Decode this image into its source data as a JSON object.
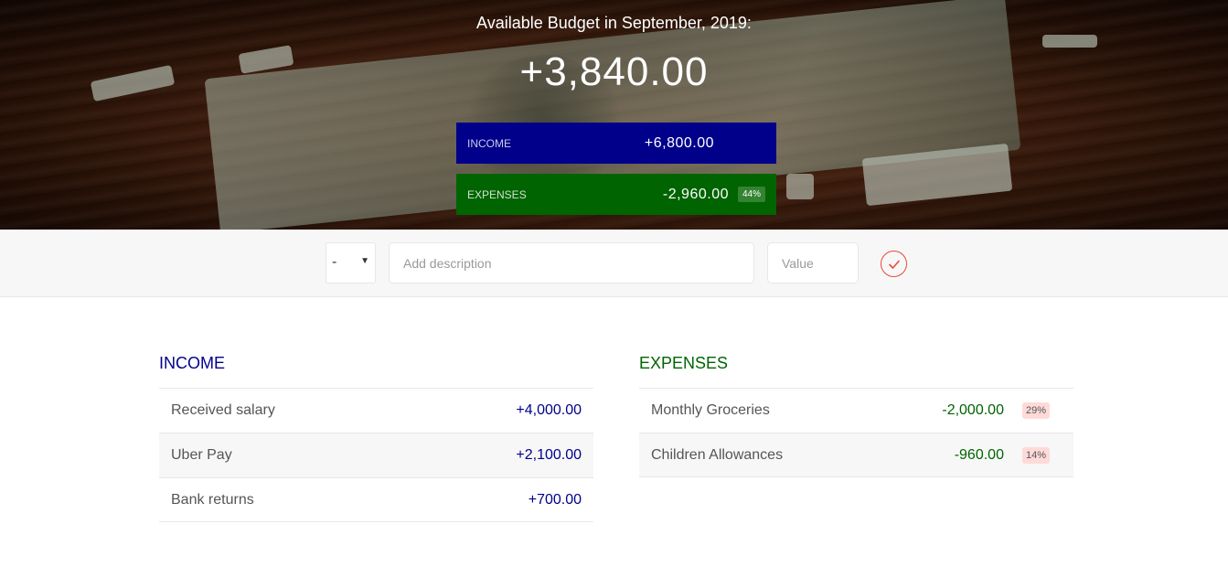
{
  "header": {
    "title": "Available Budget in September, 2019:",
    "budget": "+3,840.00",
    "income_label": "Income",
    "income_value": "+6,800.00",
    "expenses_label": "Expenses",
    "expenses_value": "-2,960.00",
    "expenses_percentage": "44%"
  },
  "add_form": {
    "type_value": "-",
    "description_placeholder": "Add description",
    "value_placeholder": "Value",
    "submit_icon": "checkmark-circle-icon"
  },
  "income": {
    "title": "Income",
    "items": [
      {
        "description": "Received salary",
        "value": "+4,000.00"
      },
      {
        "description": "Uber Pay",
        "value": "+2,100.00"
      },
      {
        "description": "Bank returns",
        "value": "+700.00"
      }
    ]
  },
  "expenses": {
    "title": "Expenses",
    "items": [
      {
        "description": "Monthly Groceries",
        "value": "-2,000.00",
        "percentage": "29%"
      },
      {
        "description": "Children Allowances",
        "value": "-960.00",
        "percentage": "14%"
      }
    ]
  },
  "colors": {
    "income": "#00008b",
    "expenses": "#006400",
    "accent": "#e74c3c"
  }
}
